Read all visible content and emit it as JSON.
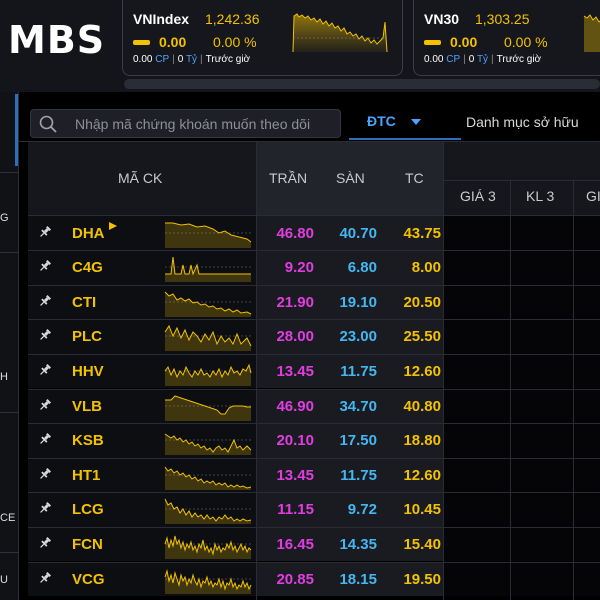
{
  "header": {
    "logo": "MBS",
    "indices": [
      {
        "name": "VNIndex",
        "value": "1,242.36",
        "change": "0.00",
        "percent": "0.00 %",
        "volume_value": "0.00",
        "volume_unit": "CP",
        "value_amount": "0",
        "value_unit": "Tỷ",
        "session": "Trước giờ"
      },
      {
        "name": "VN30",
        "value": "1,303.25",
        "change": "0.00",
        "percent": "0.00 %",
        "volume_value": "0.00",
        "volume_unit": "CP",
        "value_amount": "0",
        "value_unit": "Tỷ",
        "session": "Trước giờ"
      }
    ]
  },
  "leftnav": {
    "fragments": [
      "G",
      "H",
      "CE",
      "U"
    ]
  },
  "toolbar": {
    "search_placeholder": "Nhập mã chứng khoán muốn theo dõi",
    "tab_active": "ĐTC",
    "tab_other": "Danh mục sở hữu"
  },
  "table": {
    "headers": {
      "symbol": "MÃ CK",
      "ceiling": "TRẦN",
      "floor": "SÀN",
      "reference": "TC",
      "price3": "GIÁ 3",
      "volume3": "KL 3",
      "next": "GI"
    },
    "rows": [
      {
        "symbol": "DHA",
        "ceiling": "46.80",
        "floor": "40.70",
        "reference": "43.75",
        "flag": true
      },
      {
        "symbol": "C4G",
        "ceiling": "9.20",
        "floor": "6.80",
        "reference": "8.00",
        "flag": false
      },
      {
        "symbol": "CTI",
        "ceiling": "21.90",
        "floor": "19.10",
        "reference": "20.50",
        "flag": false
      },
      {
        "symbol": "PLC",
        "ceiling": "28.00",
        "floor": "23.00",
        "reference": "25.50",
        "flag": false
      },
      {
        "symbol": "HHV",
        "ceiling": "13.45",
        "floor": "11.75",
        "reference": "12.60",
        "flag": false
      },
      {
        "symbol": "VLB",
        "ceiling": "46.90",
        "floor": "34.70",
        "reference": "40.80",
        "flag": false
      },
      {
        "symbol": "KSB",
        "ceiling": "20.10",
        "floor": "17.50",
        "reference": "18.80",
        "flag": false
      },
      {
        "symbol": "HT1",
        "ceiling": "13.45",
        "floor": "11.75",
        "reference": "12.60",
        "flag": false
      },
      {
        "symbol": "LCG",
        "ceiling": "11.15",
        "floor": "9.72",
        "reference": "10.45",
        "flag": false
      },
      {
        "symbol": "FCN",
        "ceiling": "16.45",
        "floor": "14.35",
        "reference": "15.40",
        "flag": false
      },
      {
        "symbol": "VCG",
        "ceiling": "20.85",
        "floor": "18.15",
        "reference": "19.50",
        "flag": false
      }
    ]
  },
  "colors": {
    "accent_yellow": "#f2c200",
    "ceiling_magenta": "#e03de0",
    "floor_cyan": "#43b7f2",
    "tab_blue": "#4aa3ff"
  }
}
